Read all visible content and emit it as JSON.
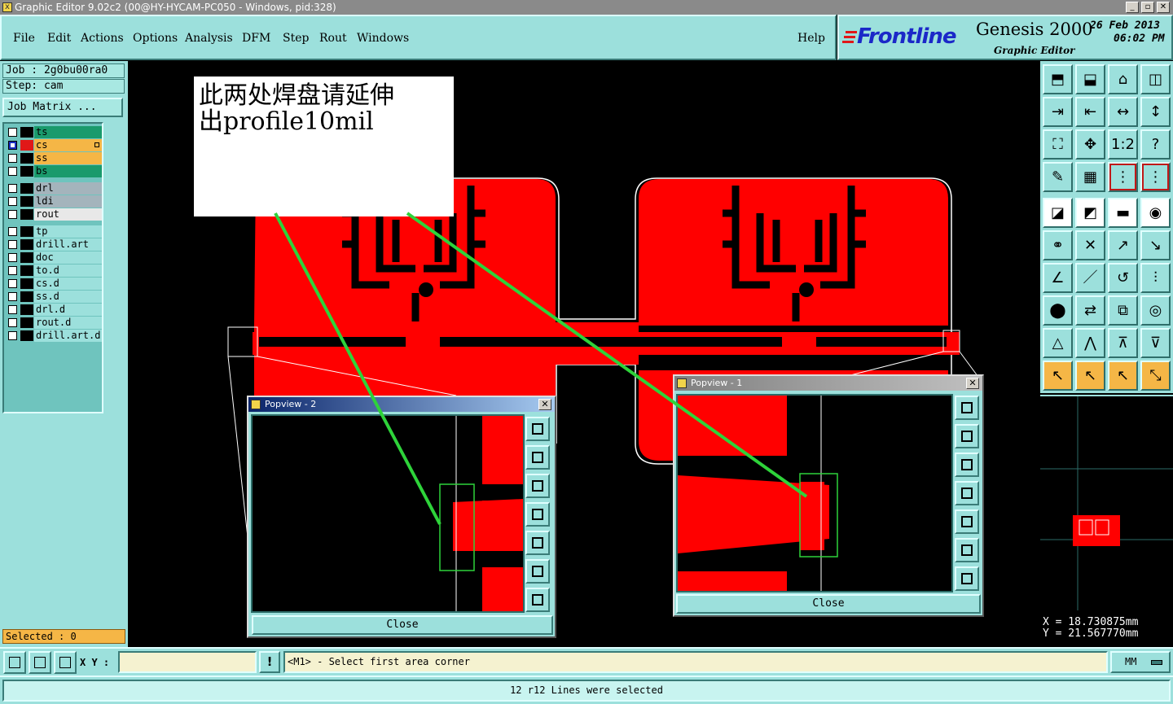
{
  "window": {
    "title": "Graphic Editor 9.02c2 (00@HY-HYCAM-PC050 - Windows, pid:328)"
  },
  "menu": {
    "items": [
      "File",
      "Edit",
      "Actions",
      "Options",
      "Analysis",
      "DFM",
      "Step",
      "Rout",
      "Windows"
    ],
    "help": "Help"
  },
  "logo": {
    "brand": "Frontline",
    "product": "Genesis 2000",
    "subtitle": "Graphic Editor",
    "date": "26 Feb 2013",
    "time": "06:02 PM"
  },
  "job": {
    "job_line": "Job : 2g0bu00ra0",
    "step_line": "Step: cam",
    "matrix_button": "Job Matrix ..."
  },
  "layers": [
    {
      "name": "ts",
      "color": "#1a9a6c",
      "swatch": "#000000",
      "active": false
    },
    {
      "name": "cs",
      "color": "#f5b646",
      "swatch": "#e01818",
      "active": true,
      "marked": true
    },
    {
      "name": "ss",
      "color": "#f5b646",
      "swatch": "#000000",
      "active": false
    },
    {
      "name": "bs",
      "color": "#1a9a6c",
      "swatch": "#000000",
      "active": false
    },
    {
      "name": "drl",
      "color": "#a4b4bc",
      "swatch": "#000000",
      "active": false
    },
    {
      "name": "ldi",
      "color": "#a4b4bc",
      "swatch": "#000000",
      "active": false
    },
    {
      "name": "rout",
      "color": "#e8e8e8",
      "swatch": "#000000",
      "active": false
    },
    {
      "name": "tp",
      "color": "#9ce0dc",
      "swatch": "#000000",
      "active": false
    },
    {
      "name": "drill.art",
      "color": "#9ce0dc",
      "swatch": "#000000",
      "active": false
    },
    {
      "name": "doc",
      "color": "#9ce0dc",
      "swatch": "#000000",
      "active": false
    },
    {
      "name": "to.d",
      "color": "#9ce0dc",
      "swatch": "#000000",
      "active": false
    },
    {
      "name": "cs.d",
      "color": "#9ce0dc",
      "swatch": "#000000",
      "active": false
    },
    {
      "name": "ss.d",
      "color": "#9ce0dc",
      "swatch": "#000000",
      "active": false
    },
    {
      "name": "drl.d",
      "color": "#9ce0dc",
      "swatch": "#000000",
      "active": false
    },
    {
      "name": "rout.d",
      "color": "#9ce0dc",
      "swatch": "#000000",
      "active": false
    },
    {
      "name": "drill.art.d",
      "color": "#9ce0dc",
      "swatch": "#000000",
      "active": false
    }
  ],
  "selected": "Selected : 0",
  "annotation": {
    "line1": "此两处焊盘请延伸",
    "line2": "出profile10mil"
  },
  "popview2": {
    "title": "Popview - 2",
    "close_label": "Close"
  },
  "popview1": {
    "title": "Popview - 1",
    "close_label": "Close"
  },
  "coords": {
    "x": "X  = 18.730875mm",
    "y": "Y  = 21.567770mm"
  },
  "bottom": {
    "xy_label": "X Y :",
    "xy_value": "",
    "prompt": "<M1> - Select first area corner",
    "units": "MM"
  },
  "status": "12 r12 Lines were selected",
  "colors": {
    "panel": "#9ce0dc",
    "copper": "#ff0000",
    "highlight": "#f5b646",
    "pointer_line": "#2ed33a"
  }
}
